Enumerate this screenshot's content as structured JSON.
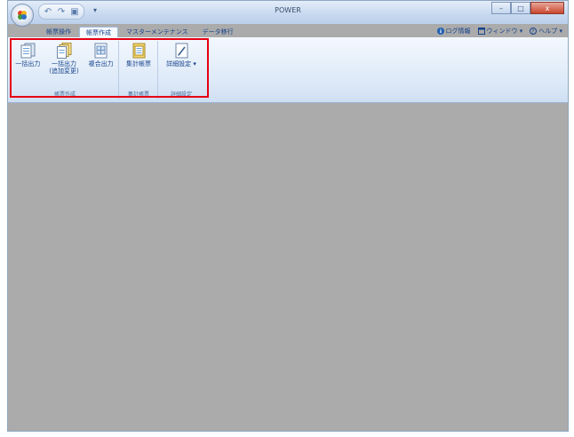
{
  "window": {
    "title": "POWER",
    "buttons": {
      "minimize": "–",
      "maximize": "□",
      "close": "x"
    }
  },
  "quick_access": {
    "items": [
      {
        "icon": "undo-icon",
        "glyph": "↶"
      },
      {
        "icon": "redo-icon",
        "glyph": "↷"
      },
      {
        "icon": "save-icon",
        "glyph": "▣"
      }
    ],
    "dropdown": "▾"
  },
  "tabs": [
    {
      "label": "帳票操作",
      "active": false
    },
    {
      "label": "帳票作成",
      "active": true
    },
    {
      "label": "マスターメンテナンス",
      "active": false
    },
    {
      "label": "データ移行",
      "active": false
    }
  ],
  "right_menu": [
    {
      "label": "ログ情報",
      "icon": "info-icon"
    },
    {
      "label": "ウィンドウ ▾",
      "icon": "window-icon"
    },
    {
      "label": "ヘルプ ▾",
      "icon": "help-icon"
    }
  ],
  "ribbon": {
    "groups": [
      {
        "title": "帳票作成",
        "buttons": [
          {
            "label": "一括出力",
            "icon": "stack-document-icon"
          },
          {
            "label": "一括出力\n(追加変更)",
            "icon": "folder-stack-icon"
          },
          {
            "label": "複合出力",
            "icon": "grid-document-icon"
          }
        ]
      },
      {
        "title": "集計帳票",
        "buttons": [
          {
            "label": "集計帳票",
            "icon": "summary-document-icon"
          }
        ]
      },
      {
        "title": "詳細設定",
        "buttons": [
          {
            "label": "詳細設定 ▾",
            "icon": "pen-settings-icon"
          }
        ]
      }
    ]
  },
  "colors": {
    "highlight": "#e60012",
    "workspace": "#ababab",
    "ribbon_text": "#15428b"
  }
}
